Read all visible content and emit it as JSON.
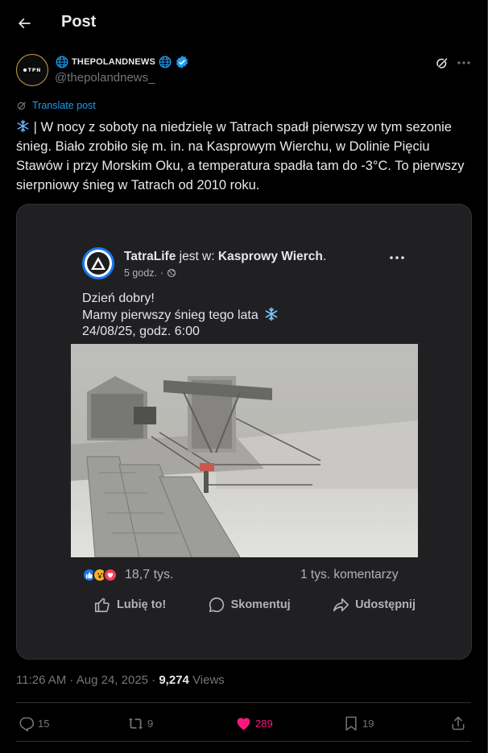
{
  "header": {
    "title": "Post"
  },
  "author": {
    "name": "THEPOLANDNEWS",
    "handle": "@thepolandnews_",
    "avatar_text": "TPN",
    "verified_color": "#1d9bf0"
  },
  "post": {
    "translate_label": "Translate post",
    "text": "| W nocy z soboty na niedzielę w Tatrach spadł pierwszy w tym sezonie śnieg. Biało zrobiło się m. in. na Kasprowym Wierchu, w Dolinie Pięciu Stawów i przy Morskim Oku, a temperatura spadła tam do -3°C. To pierwszy sierpniowy śnieg w Tatrach od 2010 roku."
  },
  "embedded": {
    "page_name": "TatraLife",
    "location_prefix": "jest w:",
    "location": "Kasprowy Wierch",
    "time": "5 godz.",
    "line1": "Dzień dobry!",
    "line2": "Mamy pierwszy śnieg tego lata",
    "line3": "24/08/25, godz. 6:00",
    "reactions_count": "18,7 tys.",
    "comments_count": "1 tys. komentarzy",
    "like_label": "Lubię to!",
    "comment_label": "Skomentuj",
    "share_label": "Udostępnij"
  },
  "meta": {
    "time": "11:26 AM · Aug 24, 2025 · ",
    "views_count": "9,274",
    "views_label": " Views"
  },
  "actions": {
    "replies": "15",
    "reposts": "9",
    "likes": "289",
    "bookmarks": "19"
  },
  "colors": {
    "accent": "#1d9bf0",
    "like": "#f91880",
    "muted": "#71767b",
    "facebook_blue": "#1877f2"
  }
}
